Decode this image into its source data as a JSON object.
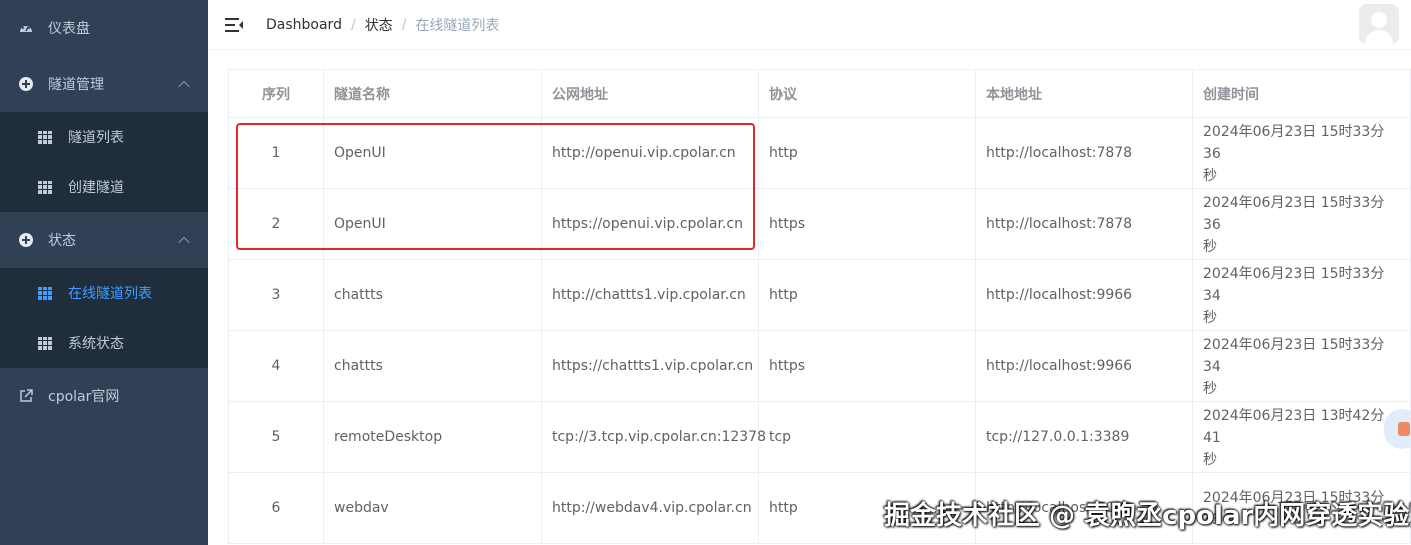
{
  "sidebar": {
    "dashboard": {
      "label": "仪表盘",
      "icon": "speedometer-icon"
    },
    "tunnel_mgmt": {
      "label": "隧道管理",
      "icon": "circle-plus-icon",
      "expanded": true,
      "children": [
        {
          "label": "隧道列表",
          "icon": "table-icon"
        },
        {
          "label": "创建隧道",
          "icon": "table-icon"
        }
      ]
    },
    "status": {
      "label": "状态",
      "icon": "circle-plus-icon",
      "expanded": true,
      "children": [
        {
          "label": "在线隧道列表",
          "icon": "table-icon",
          "active": true
        },
        {
          "label": "系统状态",
          "icon": "table-icon"
        }
      ]
    },
    "website": {
      "label": "cpolar官网",
      "icon": "external-link-icon"
    }
  },
  "navbar": {
    "breadcrumb": [
      "Dashboard",
      "状态",
      "在线隧道列表"
    ],
    "separator": "/"
  },
  "table": {
    "headers": [
      "序列",
      "隧道名称",
      "公网地址",
      "协议",
      "本地地址",
      "创建时间"
    ],
    "rows": [
      {
        "index": "1",
        "name": "OpenUI",
        "public": "http://openui.vip.cpolar.cn",
        "protocol": "http",
        "local": "http://localhost:7878",
        "time1": "2024年06月23日 15时33分36",
        "time2": "秒"
      },
      {
        "index": "2",
        "name": "OpenUI",
        "public": "https://openui.vip.cpolar.cn",
        "protocol": "https",
        "local": "http://localhost:7878",
        "time1": "2024年06月23日 15时33分36",
        "time2": "秒"
      },
      {
        "index": "3",
        "name": "chattts",
        "public": "http://chattts1.vip.cpolar.cn",
        "protocol": "http",
        "local": "http://localhost:9966",
        "time1": "2024年06月23日 15时33分34",
        "time2": "秒"
      },
      {
        "index": "4",
        "name": "chattts",
        "public": "https://chattts1.vip.cpolar.cn",
        "protocol": "https",
        "local": "http://localhost:9966",
        "time1": "2024年06月23日 15时33分34",
        "time2": "秒"
      },
      {
        "index": "5",
        "name": "remoteDesktop",
        "public": "tcp://3.tcp.vip.cpolar.cn:12378",
        "protocol": "tcp",
        "local": "tcp://127.0.0.1:3389",
        "time1": "2024年06月23日 13时42分41",
        "time2": "秒"
      },
      {
        "index": "6",
        "name": "webdav",
        "public": "http://webdav4.vip.cpolar.cn",
        "protocol": "http",
        "local": "http://localhost:8080",
        "time1": "2024年06月23日 15时33分33",
        "time2": ""
      }
    ]
  },
  "watermark": "掘金技术社区 @ 袁煦丞cpolar内网穿透实验室",
  "colors": {
    "sidebar_bg": "#304156",
    "submenu_bg": "#1f2d3d",
    "active": "#409eff",
    "highlight": "#e8262a"
  }
}
